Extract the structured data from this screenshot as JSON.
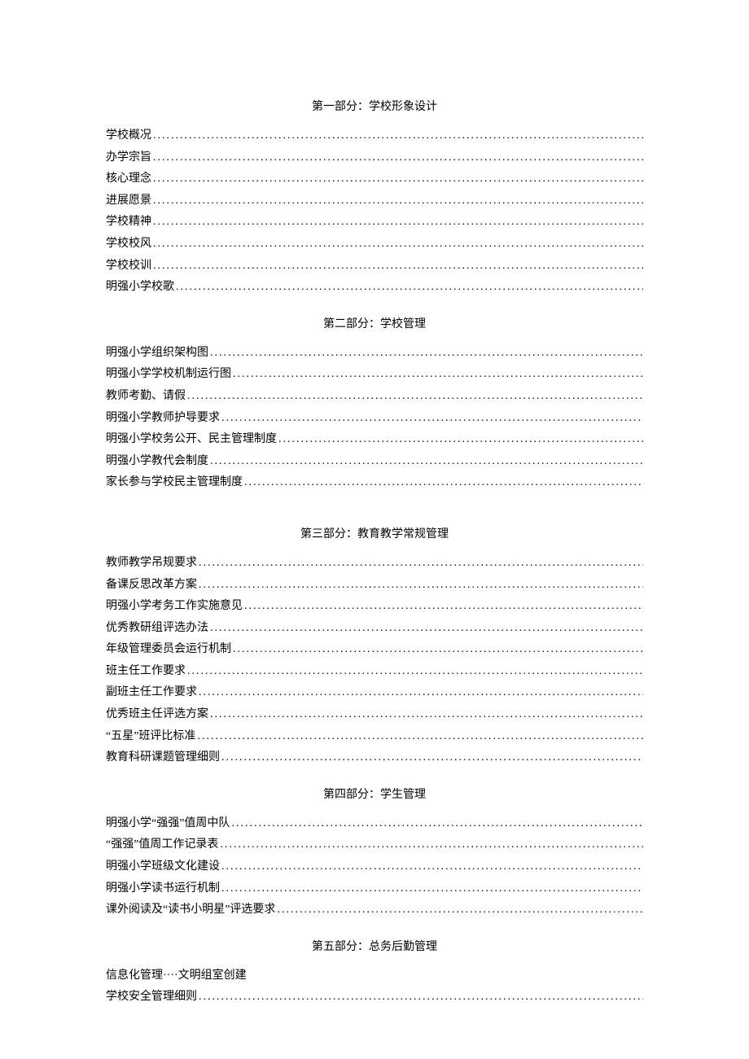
{
  "sections": [
    {
      "title": "第一部分：学校形象设计",
      "items": [
        {
          "label": "学校概况",
          "dotted": true
        },
        {
          "label": "办学宗旨",
          "dotted": true
        },
        {
          "label": "核心理念",
          "dotted": true
        },
        {
          "label": "进展愿景",
          "dotted": true
        },
        {
          "label": "学校精神",
          "dotted": true
        },
        {
          "label": "学校校风",
          "dotted": true
        },
        {
          "label": "学校校训",
          "dotted": true
        },
        {
          "label": "明强小学校歌",
          "dotted": true
        }
      ]
    },
    {
      "title": "第二部分：学校管理",
      "items": [
        {
          "label": "明强小学组织架构图",
          "dotted": true
        },
        {
          "label": "明强小学学校机制运行图",
          "dotted": true
        },
        {
          "label": "教师考勤、请假",
          "dotted": true
        },
        {
          "label": "明强小学教师护导要求",
          "dotted": true
        },
        {
          "label": "明强小学校务公开、民主管理制度",
          "dotted": true
        },
        {
          "label": "明强小学教代会制度",
          "dotted": true
        },
        {
          "label": "家长参与学校民主管理制度",
          "dotted": true
        }
      ],
      "gapAfter": true
    },
    {
      "title": "第三部分：教育教学常规管理",
      "items": [
        {
          "label": "教师教学吊规要求",
          "dotted": true
        },
        {
          "label": "备课反思改革方案",
          "dotted": true
        },
        {
          "label": "明强小学考务工作实施意见",
          "dotted": true
        },
        {
          "label": "优秀教研组评选办法",
          "dotted": true
        },
        {
          "label": "年级管理委员会运行机制",
          "dotted": true
        },
        {
          "label": "班主任工作要求",
          "dotted": true
        },
        {
          "label": "副班主任工作要求",
          "dotted": true
        },
        {
          "label": "优秀班主任评选方案",
          "dotted": true
        },
        {
          "label": "“五星”班评比标准",
          "dotted": true
        },
        {
          "label": "教育科研课题管理细则",
          "dotted": true
        }
      ]
    },
    {
      "title": "第四部分：学生管理",
      "items": [
        {
          "label": "明强小学“强强”值周中队",
          "dotted": true
        },
        {
          "label": "“强强”值周工作记录表",
          "dotted": true
        },
        {
          "label": "明强小学班级文化建设",
          "dotted": true
        },
        {
          "label": "明强小学读书运行机制",
          "dotted": true
        },
        {
          "label": "课外阅读及“读书小明星”评选要求",
          "dotted": true
        }
      ]
    },
    {
      "title": "第五部分：总务后勤管理",
      "items": [
        {
          "label": "信息化管理····文明组室创建",
          "dotted": false
        },
        {
          "label": "学校安全管理细则",
          "dotted": true
        }
      ]
    }
  ]
}
